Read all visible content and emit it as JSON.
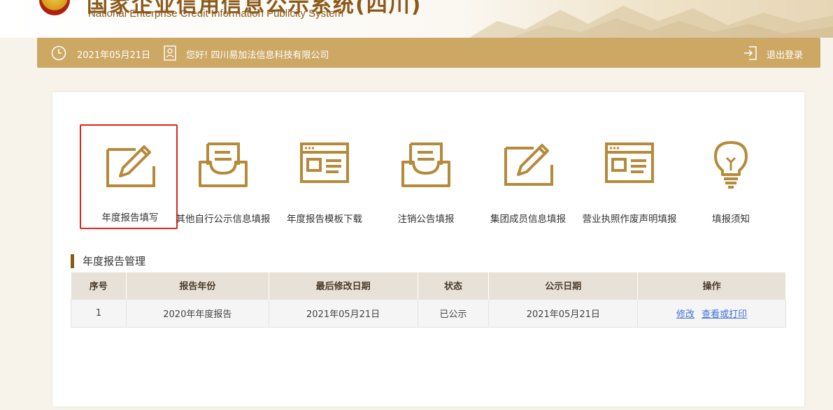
{
  "header": {
    "title_cn": "国家企业信用信息公示系统(四川)",
    "title_en": "National Enterprise Credit Information Publicity System"
  },
  "topbar": {
    "date": "2021年05月21日",
    "greeting": "您好! 四川易加法信息科技有限公司",
    "logout": "退出登录"
  },
  "functions": [
    {
      "label": "年度报告填写",
      "icon": "edit-icon",
      "selected": true
    },
    {
      "label": "其他自行公示信息填报",
      "icon": "inbox-icon"
    },
    {
      "label": "年度报告模板下载",
      "icon": "form-icon"
    },
    {
      "label": "注销公告填报",
      "icon": "inbox-icon"
    },
    {
      "label": "集团成员信息填报",
      "icon": "edit-icon"
    },
    {
      "label": "营业执照作废声明填报",
      "icon": "form-icon"
    },
    {
      "label": "填报须知",
      "icon": "lightbulb-icon"
    }
  ],
  "report_section": {
    "title": "年度报告管理",
    "columns": [
      "序号",
      "报告年份",
      "最后修改日期",
      "状态",
      "公示日期",
      "操作"
    ],
    "rows": [
      {
        "index": "1",
        "year": "2020年年度报告",
        "modified": "2021年05月21日",
        "status": "已公示",
        "publish_date": "2021年05月21日",
        "action_edit": "修改",
        "action_view": "查看或打印"
      }
    ]
  },
  "colors": {
    "gold": "#cda865",
    "icon_gold": "#b58a3a",
    "selection_border": "#e0251b",
    "link": "#3f6fd8"
  }
}
